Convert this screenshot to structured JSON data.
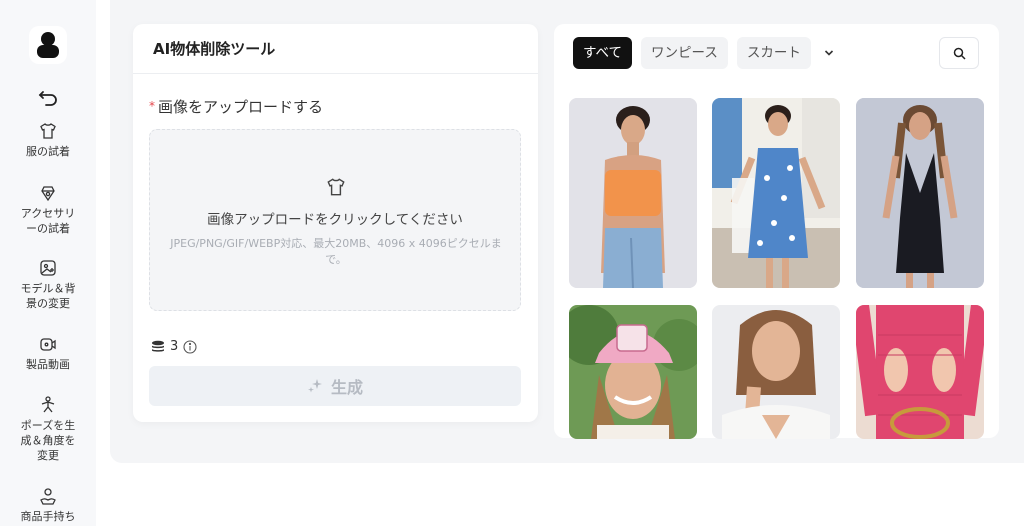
{
  "sidebar": {
    "items": [
      {
        "label": "服の試着",
        "icon": "shirt-icon"
      },
      {
        "label": "アクセサリーの試着",
        "icon": "accessory-icon"
      },
      {
        "label": "モデル＆背景の変更",
        "icon": "image-swap-icon"
      },
      {
        "label": "製品動画",
        "icon": "video-icon"
      },
      {
        "label": "ポーズを生成＆角度を変更",
        "icon": "pose-icon"
      },
      {
        "label": "商品手持ち",
        "icon": "hand-hold-icon"
      }
    ]
  },
  "panel": {
    "title": "AI物体削除ツール",
    "required_mark": "*",
    "upload_label": "画像をアップロードする",
    "dropzone_main": "画像アップロードをクリックしてください",
    "dropzone_sub": "JPEG/PNG/GIF/WEBP対応、最大20MB、4096 x 4096ピクセルまで。",
    "credits": "3",
    "generate_label": "生成"
  },
  "gallery": {
    "tabs": [
      "すべて",
      "ワンピース",
      "スカート"
    ],
    "active_tab": "すべて",
    "thumbnails": [
      {
        "subject": "orange-tube-top-jeans"
      },
      {
        "subject": "blue-floral-dress"
      },
      {
        "subject": "black-halter-dress"
      },
      {
        "subject": "pink-cap-portrait"
      },
      {
        "subject": "white-top-portrait"
      },
      {
        "subject": "pink-knit-dress"
      }
    ]
  },
  "colors": {
    "accent_active_tab": "#111111",
    "required": "#e5484d",
    "page_bg": "#f4f5f7"
  }
}
